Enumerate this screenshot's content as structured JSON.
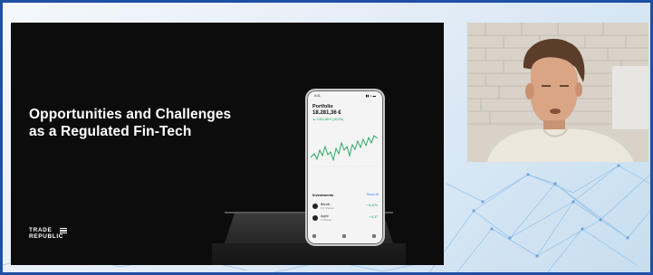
{
  "slide": {
    "title_line1": "Opportunities and Challenges",
    "title_line2": "as a Regulated Fin-Tech",
    "brand_line1": "TRADE",
    "brand_line2": "REPUBLIC"
  },
  "phone": {
    "status_time": "9:41",
    "status_icons": "▮▮ ◗ ▬",
    "screen_title": "Portfolio",
    "portfolio_value": "18.281,36 €",
    "change": "▲ 2.831,68 € (18,3%)",
    "investments_title": "Investments",
    "investments_link": "Show all",
    "holdings": [
      {
        "name": "Bitcoin",
        "sub": "0,3 Shares",
        "value": "+ 8,42%"
      },
      {
        "name": "Apple",
        "sub": "3 Shares",
        "value": "+ 6,37"
      }
    ]
  },
  "colors": {
    "frame": "#1f4fa6",
    "slide_bg": "#0c0c0c",
    "chart_line": "#19a35a"
  },
  "icons": [
    "trade-republic-logo-icon",
    "wifi-icon",
    "battery-icon",
    "home-tab-icon",
    "search-tab-icon",
    "profile-tab-icon"
  ]
}
